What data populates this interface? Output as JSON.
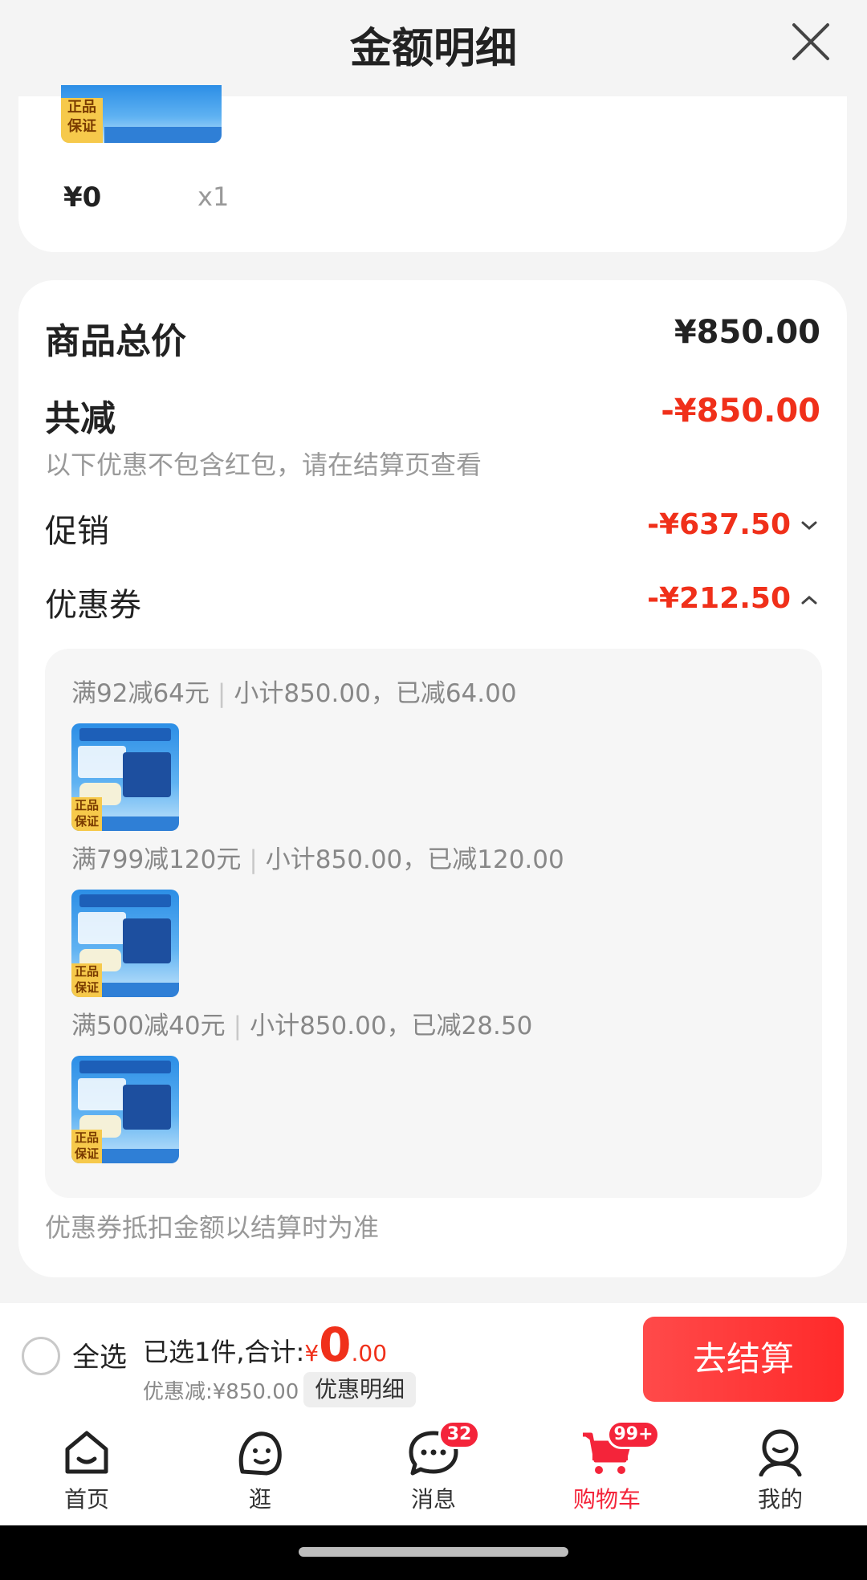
{
  "header": {
    "title": "金额明细"
  },
  "item": {
    "price": "¥0",
    "qty": "x1"
  },
  "summary": {
    "total_label": "商品总价",
    "total_value": "¥850.00",
    "reduce_label": "共减",
    "reduce_value": "-¥850.00",
    "reduce_note": "以下优惠不包含红包，请在结算页查看",
    "promo_label": "促销",
    "promo_value": "-¥637.50",
    "coupon_label": "优惠券",
    "coupon_value": "-¥212.50",
    "coupons": [
      {
        "rule": "满92减64元",
        "detail": "小计850.00，已减64.00"
      },
      {
        "rule": "满799减120元",
        "detail": "小计850.00，已减120.00"
      },
      {
        "rule": "满500减40元",
        "detail": "小计850.00，已减28.50"
      }
    ],
    "coupon_note": "优惠券抵扣金额以结算时为准"
  },
  "checkout": {
    "select_all": "全选",
    "selected_text": "已选1件,合计:",
    "currency": "¥",
    "amount_int": "0",
    "amount_dec": ".00",
    "discount_text": "优惠减:¥850.00",
    "detail_chip": "优惠明细",
    "button": "去结算"
  },
  "tabbar": {
    "items": [
      {
        "label": "首页"
      },
      {
        "label": "逛"
      },
      {
        "label": "消息",
        "badge": "32"
      },
      {
        "label": "购物车",
        "badge": "99+"
      },
      {
        "label": "我的"
      }
    ]
  },
  "colors": {
    "accent_red": "#f0301a",
    "active_tab": "#f4243a"
  },
  "icons": [
    "close-icon",
    "chevron-down-icon",
    "chevron-up-icon",
    "home-icon",
    "explore-icon",
    "message-icon",
    "cart-icon",
    "profile-icon"
  ]
}
